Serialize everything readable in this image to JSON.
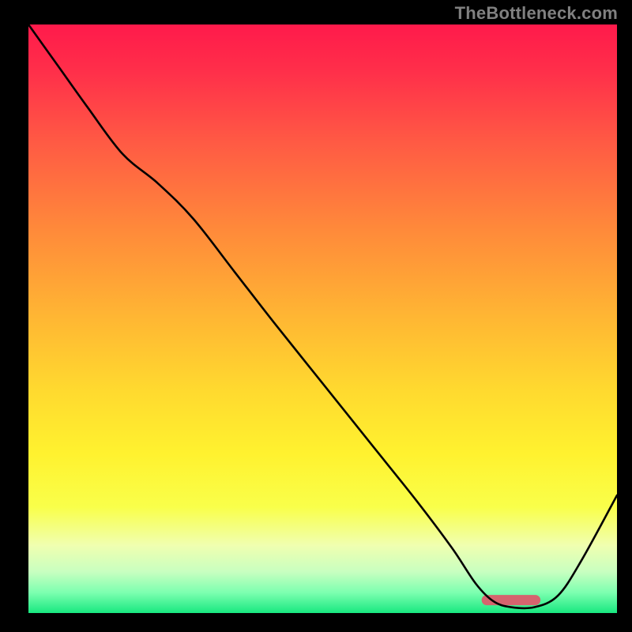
{
  "watermark": "TheBottleneck.com",
  "chart_data": {
    "type": "line",
    "title": "",
    "xlabel": "",
    "ylabel": "",
    "xlim": [
      0,
      100
    ],
    "ylim": [
      0,
      100
    ],
    "grid": false,
    "series": [
      {
        "name": "curve",
        "x": [
          0,
          5,
          10,
          16,
          22,
          28,
          35,
          42,
          50,
          58,
          66,
          72,
          76,
          79,
          82,
          86,
          90,
          94,
          100
        ],
        "y": [
          100,
          93,
          86,
          78,
          73,
          67,
          58,
          49,
          39,
          29,
          19,
          11,
          5,
          2,
          1,
          1,
          3,
          9,
          20
        ]
      }
    ],
    "marker": {
      "x_start": 77,
      "x_end": 87,
      "y": 2.2,
      "color": "#d5646e"
    },
    "gradient_stops": [
      {
        "offset": 0.0,
        "color": "#ff1a4b"
      },
      {
        "offset": 0.08,
        "color": "#ff2f4a"
      },
      {
        "offset": 0.2,
        "color": "#ff5a44"
      },
      {
        "offset": 0.35,
        "color": "#ff8a3a"
      },
      {
        "offset": 0.5,
        "color": "#ffb733"
      },
      {
        "offset": 0.62,
        "color": "#ffd92f"
      },
      {
        "offset": 0.73,
        "color": "#fff22f"
      },
      {
        "offset": 0.82,
        "color": "#f9ff4a"
      },
      {
        "offset": 0.885,
        "color": "#f0ffb0"
      },
      {
        "offset": 0.93,
        "color": "#c8ffc0"
      },
      {
        "offset": 0.965,
        "color": "#7dffb0"
      },
      {
        "offset": 1.0,
        "color": "#18e880"
      }
    ]
  }
}
